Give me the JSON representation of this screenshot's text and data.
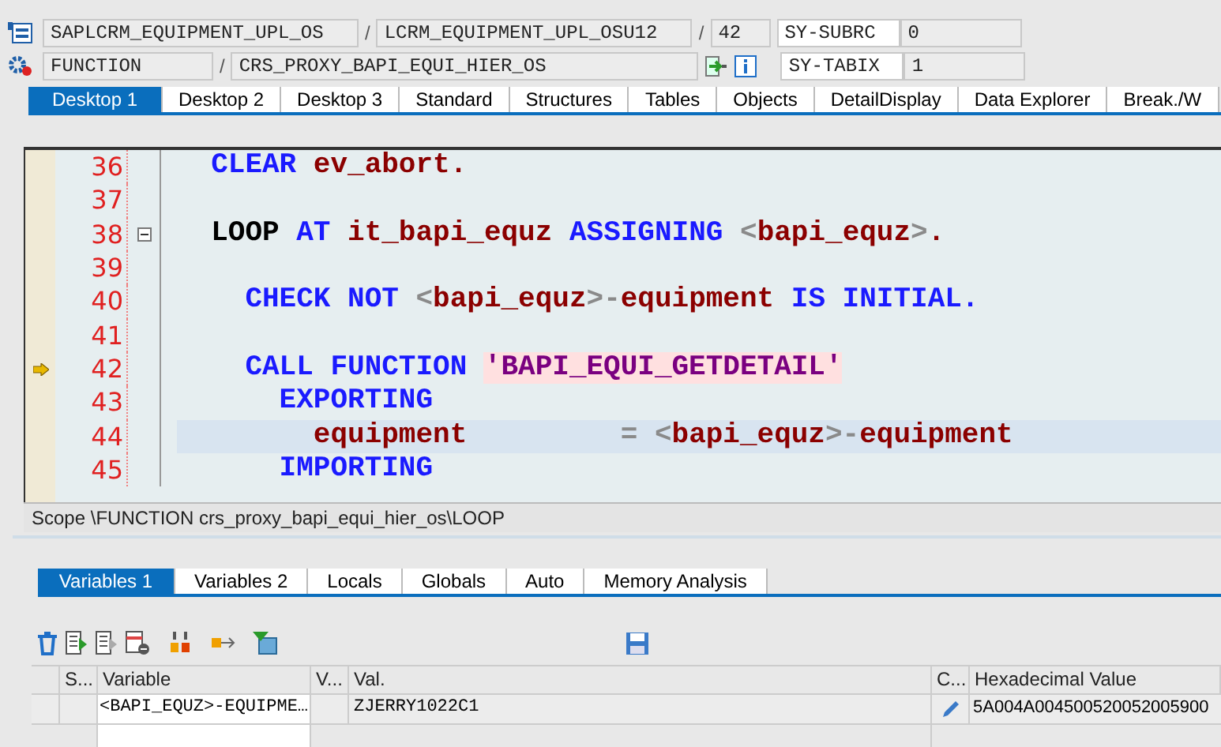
{
  "header": {
    "program": "SAPLCRM_EQUIPMENT_UPL_OS",
    "include": "LCRM_EQUIPMENT_UPL_OSU12",
    "line": "42",
    "event_type": "FUNCTION",
    "event": "CRS_PROXY_BAPI_EQUI_HIER_OS",
    "sys_fields": [
      {
        "name": "SY-SUBRC",
        "value": "0"
      },
      {
        "name": "SY-TABIX",
        "value": "1"
      }
    ],
    "separators": [
      "/",
      "/",
      "/"
    ]
  },
  "desktop_tabs": [
    {
      "label": "Desktop 1",
      "selected": true
    },
    {
      "label": "Desktop 2",
      "selected": false
    },
    {
      "label": "Desktop 3",
      "selected": false
    },
    {
      "label": "Standard",
      "selected": false
    },
    {
      "label": "Structures",
      "selected": false
    },
    {
      "label": "Tables",
      "selected": false
    },
    {
      "label": "Objects",
      "selected": false
    },
    {
      "label": "DetailDisplay",
      "selected": false
    },
    {
      "label": "Data Explorer",
      "selected": false
    },
    {
      "label": "Break./W",
      "selected": false
    }
  ],
  "code_lines": [
    {
      "number": "36",
      "current": false,
      "highlighted": false,
      "foldable": false,
      "tokens": [
        {
          "kind": "keyword",
          "text": "  CLEAR "
        },
        {
          "kind": "ident",
          "text": "ev_abort."
        }
      ]
    },
    {
      "number": "37",
      "current": false,
      "highlighted": false,
      "foldable": false
    },
    {
      "number": "38",
      "current": false,
      "highlighted": false,
      "foldable": true,
      "tokens": [
        {
          "kind": "statement",
          "text": "  LOOP "
        },
        {
          "kind": "keyword",
          "text": "AT "
        },
        {
          "kind": "ident",
          "text": "it_bapi_equz "
        },
        {
          "kind": "keyword",
          "text": "ASSIGNING "
        },
        {
          "kind": "op",
          "text": "<"
        },
        {
          "kind": "ident",
          "text": "bapi_equz"
        },
        {
          "kind": "op",
          "text": ">"
        },
        {
          "kind": "ident",
          "text": "."
        }
      ]
    },
    {
      "number": "39",
      "current": false,
      "highlighted": false,
      "foldable": false
    },
    {
      "number": "40",
      "current": false,
      "highlighted": false,
      "foldable": false,
      "tokens": [
        {
          "kind": "keyword",
          "text": "    CHECK NOT "
        },
        {
          "kind": "op",
          "text": "<"
        },
        {
          "kind": "ident",
          "text": "bapi_equz"
        },
        {
          "kind": "op",
          "text": ">-"
        },
        {
          "kind": "ident",
          "text": "equipment "
        },
        {
          "kind": "keyword",
          "text": "IS INITIAL."
        }
      ]
    },
    {
      "number": "41",
      "current": false,
      "highlighted": false,
      "foldable": false
    },
    {
      "number": "42",
      "current": true,
      "highlighted": false,
      "foldable": false,
      "tokens": [
        {
          "kind": "keyword",
          "text": "    CALL FUNCTION "
        },
        {
          "kind": "string",
          "text": "'BAPI_EQUI_GETDETAIL'"
        }
      ]
    },
    {
      "number": "43",
      "current": false,
      "highlighted": false,
      "foldable": false,
      "tokens": [
        {
          "kind": "keyword",
          "text": "      EXPORTING"
        }
      ]
    },
    {
      "number": "44",
      "current": false,
      "highlighted": true,
      "foldable": false,
      "tokens": [
        {
          "kind": "ident",
          "text": "        equipment"
        },
        {
          "kind": "op",
          "text": "         = <"
        },
        {
          "kind": "ident",
          "text": "bapi_equz"
        },
        {
          "kind": "op",
          "text": ">-"
        },
        {
          "kind": "ident",
          "text": "equipment"
        }
      ]
    },
    {
      "number": "45",
      "current": false,
      "highlighted": false,
      "foldable": false,
      "tokens": [
        {
          "kind": "keyword",
          "text": "      IMPORTING"
        }
      ]
    }
  ],
  "scope": "Scope \\FUNCTION crs_proxy_bapi_equi_hier_os\\LOOP",
  "variable_tabs": [
    {
      "label": "Variables 1",
      "selected": true
    },
    {
      "label": "Variables 2",
      "selected": false
    },
    {
      "label": "Locals",
      "selected": false
    },
    {
      "label": "Globals",
      "selected": false
    },
    {
      "label": "Auto",
      "selected": false
    },
    {
      "label": "Memory Analysis",
      "selected": false
    }
  ],
  "table": {
    "columns": [
      "S...",
      "Variable",
      "V...",
      "Val.",
      "C...",
      "Hexadecimal Value"
    ],
    "rows": [
      {
        "variable": "<BAPI_EQUZ>-EQUIPME…",
        "value": "ZJERRY1022C1",
        "hex": "5A004A004500520052005900"
      }
    ]
  }
}
